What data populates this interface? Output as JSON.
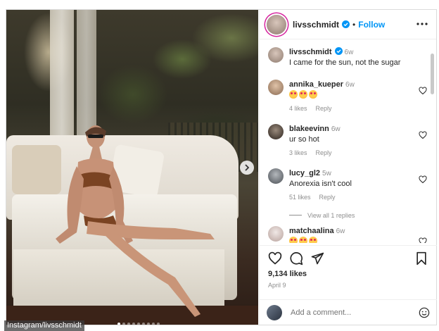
{
  "post": {
    "username": "livsschmidt",
    "follow_label": "Follow",
    "separator": "•",
    "caption": {
      "username": "livsschmidt",
      "time": "6w",
      "text": "I came for the sun, not the sugar"
    },
    "photo_count": 9,
    "active_photo_index": 0
  },
  "comments": [
    {
      "username": "annika_kueper",
      "time": "6w",
      "text": "",
      "emoji_count": 3,
      "likes": "4 likes",
      "reply": "Reply"
    },
    {
      "username": "blakeevinn",
      "time": "6w",
      "text": "ur so hot",
      "emoji_count": 0,
      "likes": "3 likes",
      "reply": "Reply"
    },
    {
      "username": "lucy_gl2",
      "time": "5w",
      "text": "Anorexia isn't cool",
      "emoji_count": 0,
      "likes": "51 likes",
      "reply": "Reply"
    },
    {
      "username": "matchaalina",
      "time": "6w",
      "text": "",
      "emoji_count": 3,
      "likes": "",
      "reply": ""
    }
  ],
  "view_all_replies": "View all 1 replies",
  "engagement": {
    "likes": "9,134 likes",
    "date": "April 9"
  },
  "add_comment": {
    "placeholder": "Add a comment..."
  },
  "watermark": "Instagram/livsschmidt",
  "colors": {
    "accent": "#0095f6",
    "muted": "#8e8e8e",
    "text": "#262626"
  }
}
